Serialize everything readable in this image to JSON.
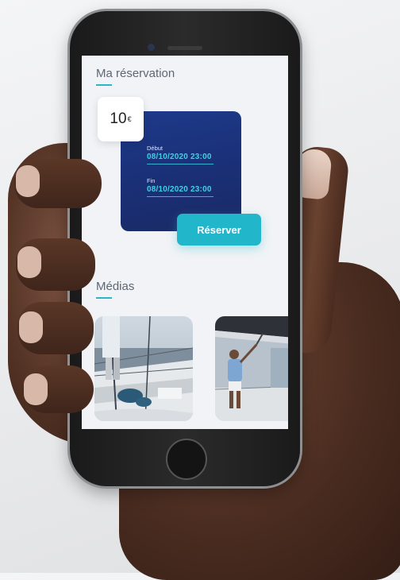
{
  "reservation": {
    "title": "Ma réservation",
    "price": "10",
    "currency": "€",
    "start_label": "Début",
    "start_value": "08/10/2020 23:00",
    "end_label": "Fin",
    "end_value": "08/10/2020 23:00",
    "reserve_label": "Réserver"
  },
  "media": {
    "title": "Médias",
    "items": [
      {
        "name": "marina-boat-photo"
      },
      {
        "name": "man-cleaning-boat-photo"
      }
    ]
  },
  "colors": {
    "accent": "#21b6ca",
    "card": "#1e3a8a",
    "screen_bg": "#f1f3f6"
  }
}
